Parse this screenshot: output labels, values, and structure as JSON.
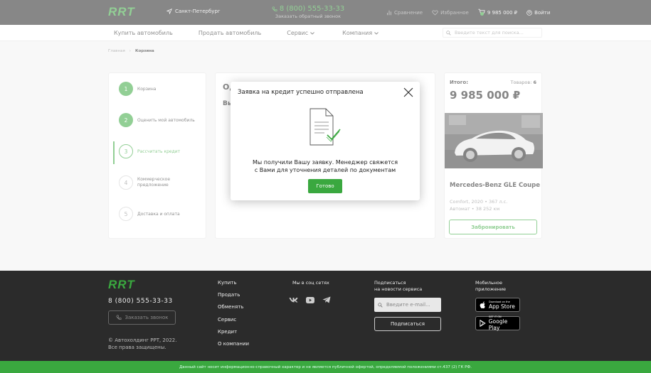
{
  "header": {
    "logo": "RRT",
    "city": "Санкт-Петербург",
    "phone": "8 (800) 555-33-33",
    "callback": "Заказать обратный звонок",
    "compare": "Сравнение",
    "favorites": "Избранное",
    "cart_total": "9 985 000 ₽",
    "login": "Войти"
  },
  "nav": {
    "items": [
      "Купить автомобиль",
      "Продать автомобиль",
      "Сервис",
      "Компания"
    ],
    "search_placeholder": "Введите текст для поиска..."
  },
  "breadcrumb": {
    "home": "Главная",
    "current": "Корзина"
  },
  "steps": [
    {
      "num": "1",
      "label": "Корзина"
    },
    {
      "num": "2",
      "label": "Оценить мой автомобиль"
    },
    {
      "num": "3",
      "label": "Рассчитать кредит"
    },
    {
      "num": "4",
      "label_line1": "Коммерческое",
      "label_line2": "предложение"
    },
    {
      "num": "5",
      "label": "Доставка и оплата"
    }
  ],
  "middle": {
    "heading_partial": "Од",
    "subheading_partial": "Вы"
  },
  "summary": {
    "total_label": "Итого:",
    "count_label": "Товаров:",
    "count": "6",
    "price": "9 985 000 ₽",
    "car_name": "Mercedes-Benz GLE Coupe",
    "spec_line1": "Comfort, 2020  •  367 л.с.",
    "spec_line2": "Автомат  •  38 252 км",
    "reserve": "Забронировать"
  },
  "modal": {
    "title": "Заявка на кредит успешно отправлена",
    "text_line1": "Мы получили Вашу заявку. Менеджер свяжется",
    "text_line2": "с Вами для уточнения деталей по документам",
    "button": "Готово"
  },
  "footer": {
    "logo": "RRT",
    "phone": "8 (800) 555-33-33",
    "callback": "Заказать звонок",
    "copyright_line1": "© Автохолдинг РРТ, 2022.",
    "copyright_line2": "Все права защищены.",
    "menu": [
      "Купить",
      "Продать",
      "Обменять",
      "Сервис",
      "Кредит",
      "О компании"
    ],
    "social_title": "Мы в соц сетях",
    "news_title_line1": "Подписаться",
    "news_title_line2": "на новости сервиса",
    "email_placeholder": "Введите e-mail...",
    "subscribe": "Подписаться",
    "apps_title_line1": "Мобильное",
    "apps_title_line2": "приложение",
    "appstore_small": "Download on the",
    "appstore_big": "App Store",
    "googleplay_small": "GET IT ON",
    "googleplay_big": "Google Play",
    "legal": "Данный сайт носит информационно-справочный характер и не является публичной офертой, определяемой положениями ст.437 (2) ГК РФ."
  },
  "colors": {
    "accent": "#3aa83f",
    "header_bg": "#262626",
    "footer_bg": "#2b2b2b"
  }
}
